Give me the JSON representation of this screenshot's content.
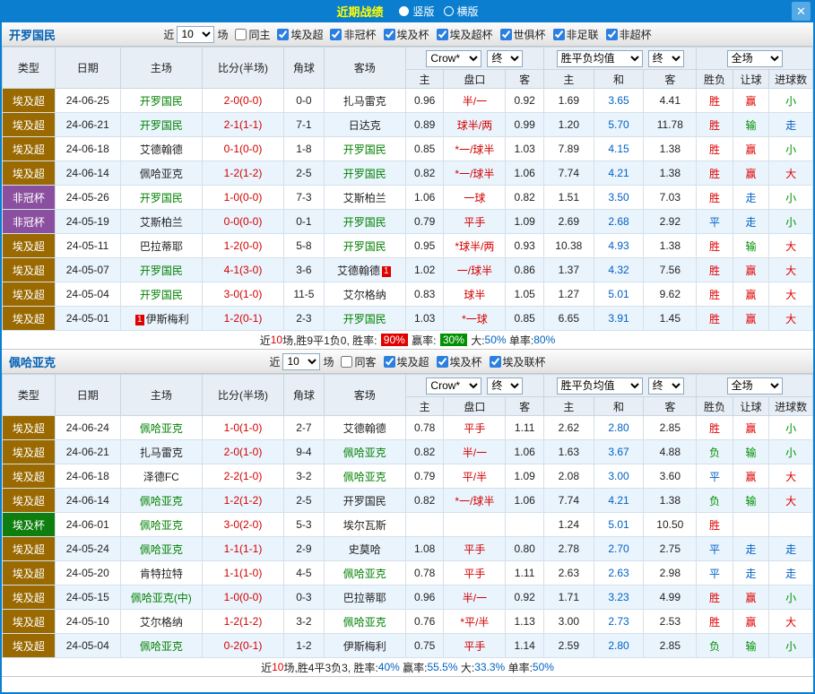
{
  "titlebar": {
    "title": "近期战绩",
    "vertical_label": "竖版",
    "horizontal_label": "横版",
    "close": "✕"
  },
  "colors": {
    "accent": "#0b7ed0",
    "focal_team": "#008000",
    "league_badge": "#9a6a00",
    "confed_badge": "#8a4f9e",
    "cup_badge": "#0e7e0e",
    "win": "#e00000",
    "draw": "#0061c1",
    "lose": "#009000"
  },
  "columns": {
    "main": [
      "类型",
      "日期",
      "主场",
      "比分(半场)",
      "角球",
      "客场"
    ],
    "sub": [
      "主",
      "盘口",
      "客",
      "主",
      "和",
      "客",
      "胜负",
      "让球",
      "进球数"
    ]
  },
  "sections": [
    {
      "team": "开罗国民",
      "filters": {
        "recent_pre": "近",
        "recent_value": "10",
        "recent_post": "场",
        "same_label": "同主",
        "same_checked": false,
        "competitions": [
          {
            "label": "埃及超",
            "checked": true
          },
          {
            "label": "非冠杯",
            "checked": true
          },
          {
            "label": "埃及杯",
            "checked": true
          },
          {
            "label": "埃及超杯",
            "checked": true
          },
          {
            "label": "世俱杯",
            "checked": true
          },
          {
            "label": "非足联",
            "checked": true
          },
          {
            "label": "非超杯",
            "checked": true
          }
        ]
      },
      "dropdowns": {
        "company": "Crow*",
        "final": "终",
        "avg": "胜平负均值",
        "scope": "全场"
      },
      "rows": [
        {
          "type": "埃及超",
          "tk": "tk-l",
          "date": "24-06-25",
          "home": "开罗国民",
          "hf": true,
          "score": "2-0(0-0)",
          "corner": "0-0",
          "away": "扎马雷克",
          "af": false,
          "ah": [
            "0.96",
            "半/一",
            "0.92"
          ],
          "eu": [
            "1.69",
            "3.65",
            "4.41"
          ],
          "res": [
            "胜",
            "r"
          ],
          "let": [
            "赢",
            "r"
          ],
          "big": [
            "小",
            "g"
          ]
        },
        {
          "type": "埃及超",
          "tk": "tk-l",
          "date": "24-06-21",
          "home": "开罗国民",
          "hf": true,
          "score": "2-1(1-1)",
          "corner": "7-1",
          "away": "日达克",
          "af": false,
          "ah": [
            "0.89",
            "球半/两",
            "0.99"
          ],
          "eu": [
            "1.20",
            "5.70",
            "11.78"
          ],
          "res": [
            "胜",
            "r"
          ],
          "let": [
            "输",
            "g"
          ],
          "big": [
            "走",
            "b"
          ]
        },
        {
          "type": "埃及超",
          "tk": "tk-l",
          "date": "24-06-18",
          "home": "艾德翰德",
          "hf": false,
          "score": "0-1(0-0)",
          "corner": "1-8",
          "away": "开罗国民",
          "af": true,
          "ah": [
            "0.85",
            "*一/球半",
            "1.03"
          ],
          "eu": [
            "7.89",
            "4.15",
            "1.38"
          ],
          "res": [
            "胜",
            "r"
          ],
          "let": [
            "赢",
            "r"
          ],
          "big": [
            "小",
            "g"
          ]
        },
        {
          "type": "埃及超",
          "tk": "tk-l",
          "date": "24-06-14",
          "home": "佩哈亚克",
          "hf": false,
          "score": "1-2(1-2)",
          "corner": "2-5",
          "away": "开罗国民",
          "af": true,
          "ah": [
            "0.82",
            "*一/球半",
            "1.06"
          ],
          "eu": [
            "7.74",
            "4.21",
            "1.38"
          ],
          "res": [
            "胜",
            "r"
          ],
          "let": [
            "赢",
            "r"
          ],
          "big": [
            "大",
            "r"
          ]
        },
        {
          "type": "非冠杯",
          "tk": "tk-c",
          "date": "24-05-26",
          "home": "开罗国民",
          "hf": true,
          "score": "1-0(0-0)",
          "corner": "7-3",
          "away": "艾斯柏兰",
          "af": false,
          "ah": [
            "1.06",
            "一球",
            "0.82"
          ],
          "eu": [
            "1.51",
            "3.50",
            "7.03"
          ],
          "res": [
            "胜",
            "r"
          ],
          "let": [
            "走",
            "b"
          ],
          "big": [
            "小",
            "g"
          ]
        },
        {
          "type": "非冠杯",
          "tk": "tk-c",
          "date": "24-05-19",
          "home": "艾斯柏兰",
          "hf": false,
          "score": "0-0(0-0)",
          "corner": "0-1",
          "away": "开罗国民",
          "af": true,
          "ah": [
            "0.79",
            "平手",
            "1.09"
          ],
          "eu": [
            "2.69",
            "2.68",
            "2.92"
          ],
          "res": [
            "平",
            "b"
          ],
          "let": [
            "走",
            "b"
          ],
          "big": [
            "小",
            "g"
          ]
        },
        {
          "type": "埃及超",
          "tk": "tk-l",
          "date": "24-05-11",
          "home": "巴拉蒂耶",
          "hf": false,
          "score": "1-2(0-0)",
          "corner": "5-8",
          "away": "开罗国民",
          "af": true,
          "ah": [
            "0.95",
            "*球半/两",
            "0.93"
          ],
          "eu": [
            "10.38",
            "4.93",
            "1.38"
          ],
          "res": [
            "胜",
            "r"
          ],
          "let": [
            "输",
            "g"
          ],
          "big": [
            "大",
            "r"
          ]
        },
        {
          "type": "埃及超",
          "tk": "tk-l",
          "date": "24-05-07",
          "home": "开罗国民",
          "hf": true,
          "score": "4-1(3-0)",
          "corner": "3-6",
          "away": "艾德翰德",
          "af": false,
          "ab": "1",
          "ah": [
            "1.02",
            "一/球半",
            "0.86"
          ],
          "eu": [
            "1.37",
            "4.32",
            "7.56"
          ],
          "res": [
            "胜",
            "r"
          ],
          "let": [
            "赢",
            "r"
          ],
          "big": [
            "大",
            "r"
          ]
        },
        {
          "type": "埃及超",
          "tk": "tk-l",
          "date": "24-05-04",
          "home": "开罗国民",
          "hf": true,
          "score": "3-0(1-0)",
          "corner": "11-5",
          "away": "艾尔格纳",
          "af": false,
          "ah": [
            "0.83",
            "球半",
            "1.05"
          ],
          "eu": [
            "1.27",
            "5.01",
            "9.62"
          ],
          "res": [
            "胜",
            "r"
          ],
          "let": [
            "赢",
            "r"
          ],
          "big": [
            "大",
            "r"
          ]
        },
        {
          "type": "埃及超",
          "tk": "tk-l",
          "date": "24-05-01",
          "home": "伊斯梅利",
          "hf": false,
          "hb": "1",
          "score": "1-2(0-1)",
          "corner": "2-3",
          "away": "开罗国民",
          "af": true,
          "ah": [
            "1.03",
            "*一球",
            "0.85"
          ],
          "eu": [
            "6.65",
            "3.91",
            "1.45"
          ],
          "res": [
            "胜",
            "r"
          ],
          "let": [
            "赢",
            "r"
          ],
          "big": [
            "大",
            "r"
          ]
        }
      ],
      "footer": [
        {
          "t": "近",
          "c": ""
        },
        {
          "t": "10",
          "c": "cr"
        },
        {
          "t": "场,胜9平1负0, 胜率: ",
          "c": ""
        },
        {
          "t": "90%",
          "c": "bdg-r"
        },
        {
          "t": " 赢率: ",
          "c": ""
        },
        {
          "t": "30%",
          "c": "bdg-g"
        },
        {
          "t": " 大:",
          "c": ""
        },
        {
          "t": "50%",
          "c": "cb"
        },
        {
          "t": " 单率:",
          "c": ""
        },
        {
          "t": "80%",
          "c": "cb"
        }
      ]
    },
    {
      "team": "佩哈亚克",
      "filters": {
        "recent_pre": "近",
        "recent_value": "10",
        "recent_post": "场",
        "same_label": "同客",
        "same_checked": false,
        "competitions": [
          {
            "label": "埃及超",
            "checked": true
          },
          {
            "label": "埃及杯",
            "checked": true
          },
          {
            "label": "埃及联杯",
            "checked": true
          }
        ]
      },
      "dropdowns": {
        "company": "Crow*",
        "final": "终",
        "avg": "胜平负均值",
        "scope": "全场"
      },
      "rows": [
        {
          "type": "埃及超",
          "tk": "tk-l",
          "date": "24-06-24",
          "home": "佩哈亚克",
          "hf": true,
          "score": "1-0(1-0)",
          "corner": "2-7",
          "away": "艾德翰德",
          "af": false,
          "ah": [
            "0.78",
            "平手",
            "1.11"
          ],
          "eu": [
            "2.62",
            "2.80",
            "2.85"
          ],
          "res": [
            "胜",
            "r"
          ],
          "let": [
            "赢",
            "r"
          ],
          "big": [
            "小",
            "g"
          ]
        },
        {
          "type": "埃及超",
          "tk": "tk-l",
          "date": "24-06-21",
          "home": "扎马雷克",
          "hf": false,
          "score": "2-0(1-0)",
          "corner": "9-4",
          "away": "佩哈亚克",
          "af": true,
          "ah": [
            "0.82",
            "半/一",
            "1.06"
          ],
          "eu": [
            "1.63",
            "3.67",
            "4.88"
          ],
          "res": [
            "负",
            "g"
          ],
          "let": [
            "输",
            "g"
          ],
          "big": [
            "小",
            "g"
          ]
        },
        {
          "type": "埃及超",
          "tk": "tk-l",
          "date": "24-06-18",
          "home": "泽德FC",
          "hf": false,
          "score": "2-2(1-0)",
          "corner": "3-2",
          "away": "佩哈亚克",
          "af": true,
          "ah": [
            "0.79",
            "平/半",
            "1.09"
          ],
          "eu": [
            "2.08",
            "3.00",
            "3.60"
          ],
          "res": [
            "平",
            "b"
          ],
          "let": [
            "赢",
            "r"
          ],
          "big": [
            "大",
            "r"
          ]
        },
        {
          "type": "埃及超",
          "tk": "tk-l",
          "date": "24-06-14",
          "home": "佩哈亚克",
          "hf": true,
          "score": "1-2(1-2)",
          "corner": "2-5",
          "away": "开罗国民",
          "af": false,
          "ah": [
            "0.82",
            "*一/球半",
            "1.06"
          ],
          "eu": [
            "7.74",
            "4.21",
            "1.38"
          ],
          "res": [
            "负",
            "g"
          ],
          "let": [
            "输",
            "g"
          ],
          "big": [
            "大",
            "r"
          ]
        },
        {
          "type": "埃及杯",
          "tk": "tk-k",
          "date": "24-06-01",
          "home": "佩哈亚克",
          "hf": true,
          "score": "3-0(2-0)",
          "corner": "5-3",
          "away": "埃尔瓦斯",
          "af": false,
          "ah": [
            "",
            "",
            ""
          ],
          "eu": [
            "1.24",
            "5.01",
            "10.50"
          ],
          "res": [
            "胜",
            "r"
          ],
          "let": [
            "",
            ""
          ],
          "big": [
            "",
            ""
          ]
        },
        {
          "type": "埃及超",
          "tk": "tk-l",
          "date": "24-05-24",
          "home": "佩哈亚克",
          "hf": true,
          "score": "1-1(1-1)",
          "corner": "2-9",
          "away": "史莫哈",
          "af": false,
          "ah": [
            "1.08",
            "平手",
            "0.80"
          ],
          "eu": [
            "2.78",
            "2.70",
            "2.75"
          ],
          "res": [
            "平",
            "b"
          ],
          "let": [
            "走",
            "b"
          ],
          "big": [
            "走",
            "b"
          ]
        },
        {
          "type": "埃及超",
          "tk": "tk-l",
          "date": "24-05-20",
          "home": "肯特拉特",
          "hf": false,
          "score": "1-1(1-0)",
          "corner": "4-5",
          "away": "佩哈亚克",
          "af": true,
          "ah": [
            "0.78",
            "平手",
            "1.11"
          ],
          "eu": [
            "2.63",
            "2.63",
            "2.98"
          ],
          "res": [
            "平",
            "b"
          ],
          "let": [
            "走",
            "b"
          ],
          "big": [
            "走",
            "b"
          ]
        },
        {
          "type": "埃及超",
          "tk": "tk-l",
          "date": "24-05-15",
          "home": "佩哈亚克(中)",
          "hf": true,
          "score": "1-0(0-0)",
          "corner": "0-3",
          "away": "巴拉蒂耶",
          "af": false,
          "ah": [
            "0.96",
            "半/一",
            "0.92"
          ],
          "eu": [
            "1.71",
            "3.23",
            "4.99"
          ],
          "res": [
            "胜",
            "r"
          ],
          "let": [
            "赢",
            "r"
          ],
          "big": [
            "小",
            "g"
          ]
        },
        {
          "type": "埃及超",
          "tk": "tk-l",
          "date": "24-05-10",
          "home": "艾尔格纳",
          "hf": false,
          "score": "1-2(1-2)",
          "corner": "3-2",
          "away": "佩哈亚克",
          "af": true,
          "ah": [
            "0.76",
            "*平/半",
            "1.13"
          ],
          "eu": [
            "3.00",
            "2.73",
            "2.53"
          ],
          "res": [
            "胜",
            "r"
          ],
          "let": [
            "赢",
            "r"
          ],
          "big": [
            "大",
            "r"
          ]
        },
        {
          "type": "埃及超",
          "tk": "tk-l",
          "date": "24-05-04",
          "home": "佩哈亚克",
          "hf": true,
          "score": "0-2(0-1)",
          "corner": "1-2",
          "away": "伊斯梅利",
          "af": false,
          "ah": [
            "0.75",
            "平手",
            "1.14"
          ],
          "eu": [
            "2.59",
            "2.80",
            "2.85"
          ],
          "res": [
            "负",
            "g"
          ],
          "let": [
            "输",
            "g"
          ],
          "big": [
            "小",
            "g"
          ]
        }
      ],
      "footer": [
        {
          "t": "近",
          "c": ""
        },
        {
          "t": "10",
          "c": "cr"
        },
        {
          "t": "场,胜4平3负3, 胜率:",
          "c": ""
        },
        {
          "t": "40%",
          "c": "cb"
        },
        {
          "t": " 赢率:",
          "c": ""
        },
        {
          "t": "55.5%",
          "c": "cb"
        },
        {
          "t": " 大:",
          "c": ""
        },
        {
          "t": "33.3%",
          "c": "cb"
        },
        {
          "t": " 单率:",
          "c": ""
        },
        {
          "t": "50%",
          "c": "cb"
        }
      ]
    }
  ]
}
